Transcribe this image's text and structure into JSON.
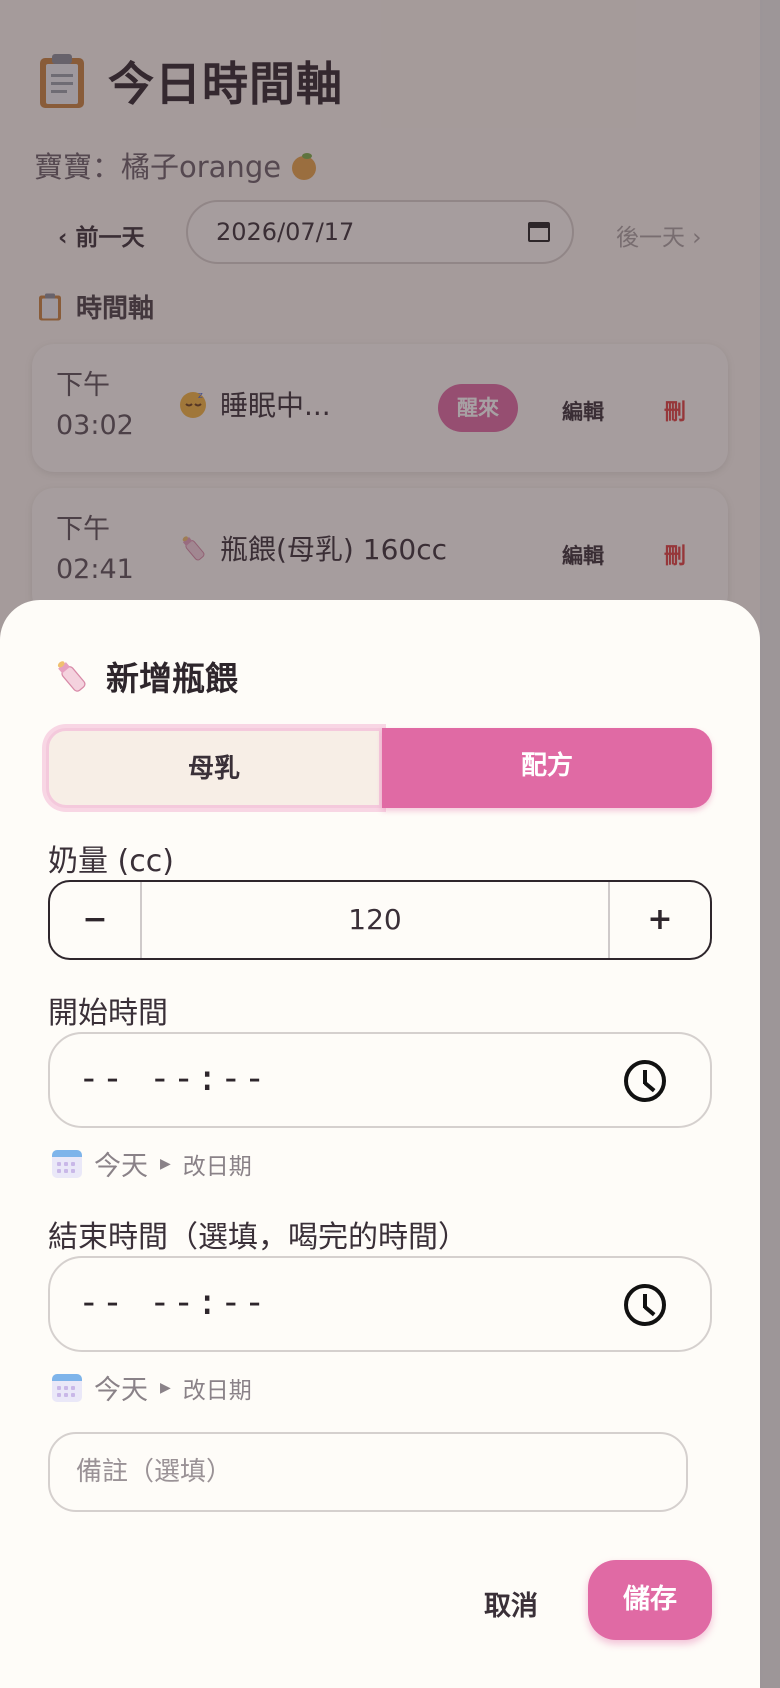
{
  "page": {
    "title": "今日時間軸",
    "baby_label": "寶寶：橘子orange",
    "prev_day": "‹ 前一天",
    "date_value": "2026/07/17",
    "next_day": "後一天 ›",
    "section_title": "時間軸"
  },
  "timeline": [
    {
      "period": "下午",
      "time": "03:02",
      "event": "睡眠中...",
      "action": "醒來",
      "edit": "編輯",
      "delete": "刪"
    },
    {
      "period": "下午",
      "time": "02:41",
      "event": "瓶餵(母乳) 160cc",
      "edit": "編輯",
      "delete": "刪"
    }
  ],
  "sheet": {
    "title": "新增瓶餵",
    "options": [
      "母乳",
      "配方"
    ],
    "selected_option": "配方",
    "amount_label": "奶量 (cc)",
    "amount_minus": "−",
    "amount_value": "120",
    "amount_plus": "+",
    "start_label": "開始時間",
    "time_placeholder": "-- --:--",
    "start_date": "今天",
    "change_date": "改日期",
    "end_label": "結束時間（選填，喝完的時間）",
    "end_date": "今天",
    "notes_placeholder": "備註（選填）",
    "cancel": "取消",
    "save": "儲存"
  },
  "colors": {
    "accent": "#e06aa4",
    "background": "#fbf6f0",
    "delete": "#e04040"
  },
  "icons": [
    "clipboard-icon",
    "orange-icon",
    "calendar-icon",
    "sleeping-face-icon",
    "baby-bottle-icon",
    "clock-icon"
  ]
}
